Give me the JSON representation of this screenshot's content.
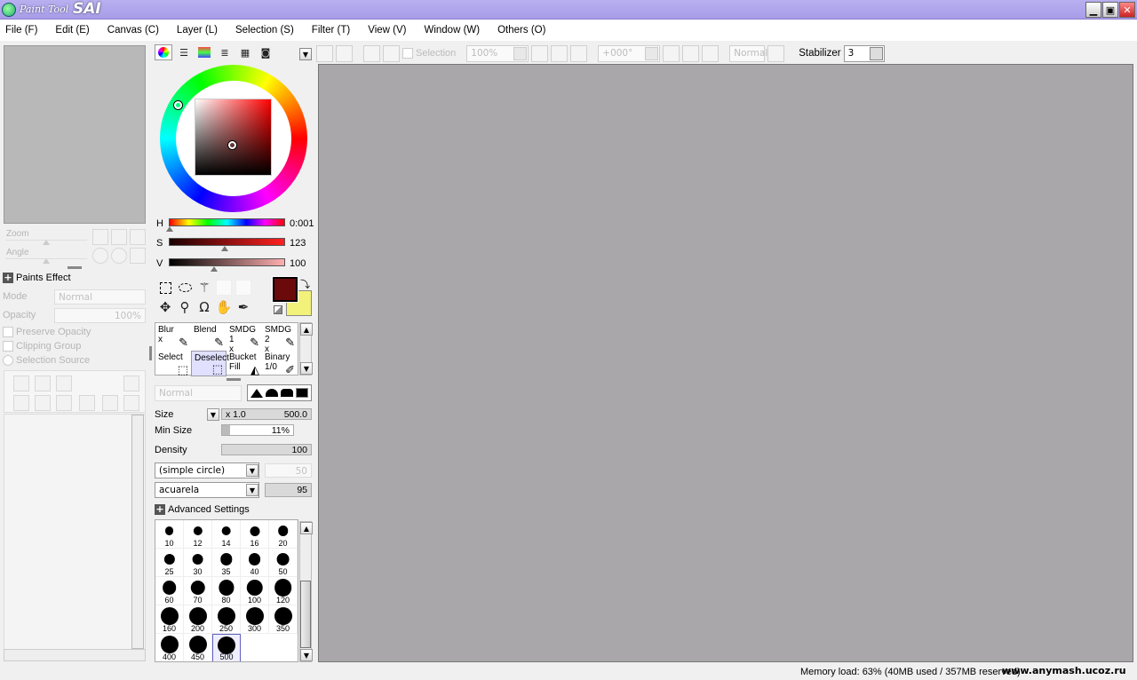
{
  "app": {
    "logo_small": "Paint Tool",
    "logo_big": "SAI"
  },
  "window_buttons": {
    "minimize": "▁",
    "maximize": "▣",
    "close": "✕"
  },
  "menu": [
    "File (F)",
    "Edit (E)",
    "Canvas (C)",
    "Layer (L)",
    "Selection (S)",
    "Filter (T)",
    "View (V)",
    "Window (W)",
    "Others (O)"
  ],
  "toolbar": {
    "selection_label": "Selection",
    "zoom": "100%",
    "rotation": "+000°",
    "blend_mode": "Normal",
    "stabilizer_label": "Stabilizer",
    "stabilizer_value": "3"
  },
  "navigator": {
    "zoom_label": "Zoom",
    "angle_label": "Angle"
  },
  "layer_panel": {
    "paints_effect": "Paints Effect",
    "mode_label": "Mode",
    "mode_value": "Normal",
    "opacity_label": "Opacity",
    "opacity_value": "100%",
    "preserve_opacity": "Preserve Opacity",
    "clipping_group": "Clipping Group",
    "selection_source": "Selection Source"
  },
  "color": {
    "h_label": "H",
    "h_value": "0:001",
    "h_pos": 0.01,
    "s_label": "S",
    "s_value": "123",
    "s_pos": 0.48,
    "v_label": "V",
    "v_value": "100",
    "v_pos": 0.39,
    "primary": "#6b0a0a",
    "secondary": "#f2f27a"
  },
  "brushes": [
    {
      "name": "Blur",
      "sub": "x",
      "icon": "✎"
    },
    {
      "name": "Blend",
      "sub": "",
      "icon": "✎"
    },
    {
      "name": "SMDG 1",
      "sub": "x",
      "icon": "✎"
    },
    {
      "name": "SMDG 2",
      "sub": "x",
      "icon": "✎"
    },
    {
      "name": "Select",
      "sub": "",
      "icon": "⬚"
    },
    {
      "name": "Deselect",
      "sub": "",
      "icon": "⬚"
    },
    {
      "name": "Bucket",
      "sub": "Fill",
      "icon": "◭"
    },
    {
      "name": "Binary",
      "sub": "1/0",
      "icon": "✐"
    }
  ],
  "brush_settings": {
    "blend_mode": "Normal",
    "size_label": "Size",
    "size_mult": "x 1.0",
    "size_value": "500.0",
    "min_size_label": "Min Size",
    "min_size_value": "11%",
    "density_label": "Density",
    "density_value": "100",
    "shape": "(simple circle)",
    "shape_value": "50",
    "texture": "acuarela",
    "texture_value": "95",
    "advanced": "Advanced Settings"
  },
  "sizes": [
    "10",
    "12",
    "14",
    "16",
    "20",
    "25",
    "30",
    "35",
    "40",
    "50",
    "60",
    "70",
    "80",
    "100",
    "120",
    "160",
    "200",
    "250",
    "300",
    "350",
    "400",
    "450",
    "500"
  ],
  "selected_size": "500",
  "status": {
    "memory": "Memory load: 63% (40MB used / 357MB reserved)",
    "watermark": "www.anymash.ucoz.ru"
  }
}
